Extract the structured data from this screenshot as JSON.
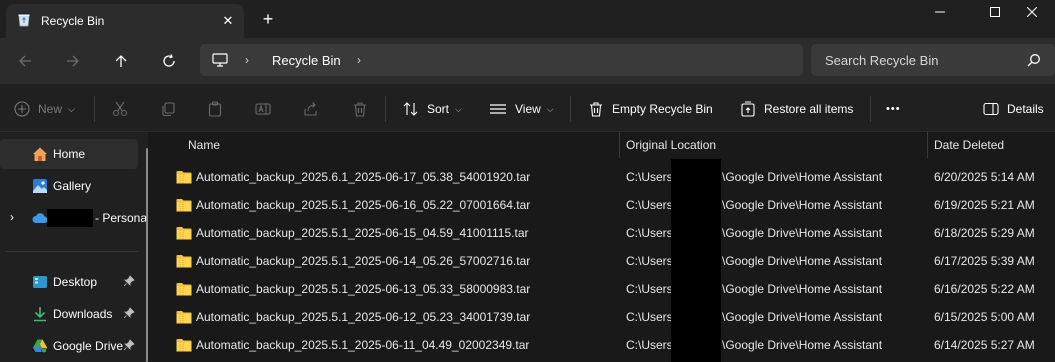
{
  "window": {
    "tab_title": "Recycle Bin",
    "close_tab_symbol": "✕",
    "new_tab_symbol": "+"
  },
  "address": {
    "location": "Recycle Bin",
    "search_placeholder": "Search Recycle Bin"
  },
  "commands": {
    "new_label": "New",
    "sort_label": "Sort",
    "view_label": "View",
    "empty_label": "Empty Recycle Bin",
    "restore_label": "Restore all items",
    "more_label": "•••",
    "details_label": "Details"
  },
  "sidebar": {
    "home": "Home",
    "gallery": "Gallery",
    "onedrive_suffix": "- Persona",
    "desktop": "Desktop",
    "downloads": "Downloads",
    "google_drive": "Google Drive"
  },
  "table": {
    "columns": {
      "name": "Name",
      "location": "Original Location",
      "date": "Date Deleted"
    },
    "rows": [
      {
        "name": "Automatic_backup_2025.6.1_2025-06-17_05.38_54001920.tar",
        "loc_prefix": "C:\\Users",
        "loc_suffix": "\\Google Drive\\Home Assistant",
        "date": "6/20/2025 5:14 AM"
      },
      {
        "name": "Automatic_backup_2025.5.1_2025-06-16_05.22_07001664.tar",
        "loc_prefix": "C:\\Users",
        "loc_suffix": "\\Google Drive\\Home Assistant",
        "date": "6/19/2025 5:21 AM"
      },
      {
        "name": "Automatic_backup_2025.5.1_2025-06-15_04.59_41001115.tar",
        "loc_prefix": "C:\\Users",
        "loc_suffix": "\\Google Drive\\Home Assistant",
        "date": "6/18/2025 5:29 AM"
      },
      {
        "name": "Automatic_backup_2025.5.1_2025-06-14_05.26_57002716.tar",
        "loc_prefix": "C:\\Users",
        "loc_suffix": "\\Google Drive\\Home Assistant",
        "date": "6/17/2025 5:39 AM"
      },
      {
        "name": "Automatic_backup_2025.5.1_2025-06-13_05.33_58000983.tar",
        "loc_prefix": "C:\\Users",
        "loc_suffix": "\\Google Drive\\Home Assistant",
        "date": "6/16/2025 5:22 AM"
      },
      {
        "name": "Automatic_backup_2025.5.1_2025-06-12_05.23_34001739.tar",
        "loc_prefix": "C:\\Users",
        "loc_suffix": "\\Google Drive\\Home Assistant",
        "date": "6/15/2025 5:00 AM"
      },
      {
        "name": "Automatic_backup_2025.5.1_2025-06-11_04.49_02002349.tar",
        "loc_prefix": "C:\\Users",
        "loc_suffix": "\\Google Drive\\Home Assistant",
        "date": "6/14/2025 5:27 AM"
      }
    ]
  }
}
